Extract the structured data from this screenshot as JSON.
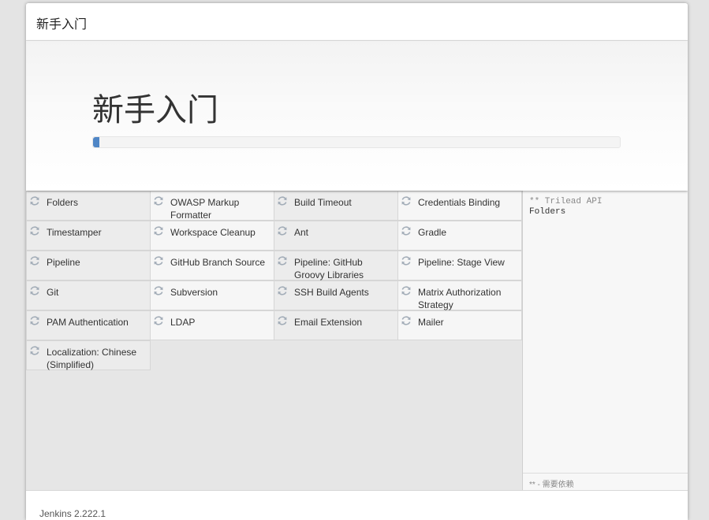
{
  "header": {
    "title": "新手入门"
  },
  "jumbotron": {
    "title": "新手入门",
    "progress_fraction": 0.012
  },
  "plugins": [
    {
      "name": "Folders"
    },
    {
      "name": "OWASP Markup Formatter"
    },
    {
      "name": "Build Timeout"
    },
    {
      "name": "Credentials Binding"
    },
    {
      "name": "Timestamper"
    },
    {
      "name": "Workspace Cleanup"
    },
    {
      "name": "Ant"
    },
    {
      "name": "Gradle"
    },
    {
      "name": "Pipeline"
    },
    {
      "name": "GitHub Branch Source"
    },
    {
      "name": "Pipeline: GitHub Groovy Libraries"
    },
    {
      "name": "Pipeline: Stage View"
    },
    {
      "name": "Git"
    },
    {
      "name": "Subversion"
    },
    {
      "name": "SSH Build Agents"
    },
    {
      "name": "Matrix Authorization Strategy"
    },
    {
      "name": "PAM Authentication"
    },
    {
      "name": "LDAP"
    },
    {
      "name": "Email Extension"
    },
    {
      "name": "Mailer"
    },
    {
      "name": "Localization: Chinese (Simplified)"
    }
  ],
  "install_log": {
    "line1": "** Trilead API",
    "line2": "Folders"
  },
  "legend": "** - 需要依赖",
  "footer": {
    "version": "Jenkins 2.222.1"
  },
  "colors": {
    "progress": "#4f86c6",
    "icon": "#a3adb8"
  },
  "icons": {
    "plugin_status": "refresh-icon"
  }
}
